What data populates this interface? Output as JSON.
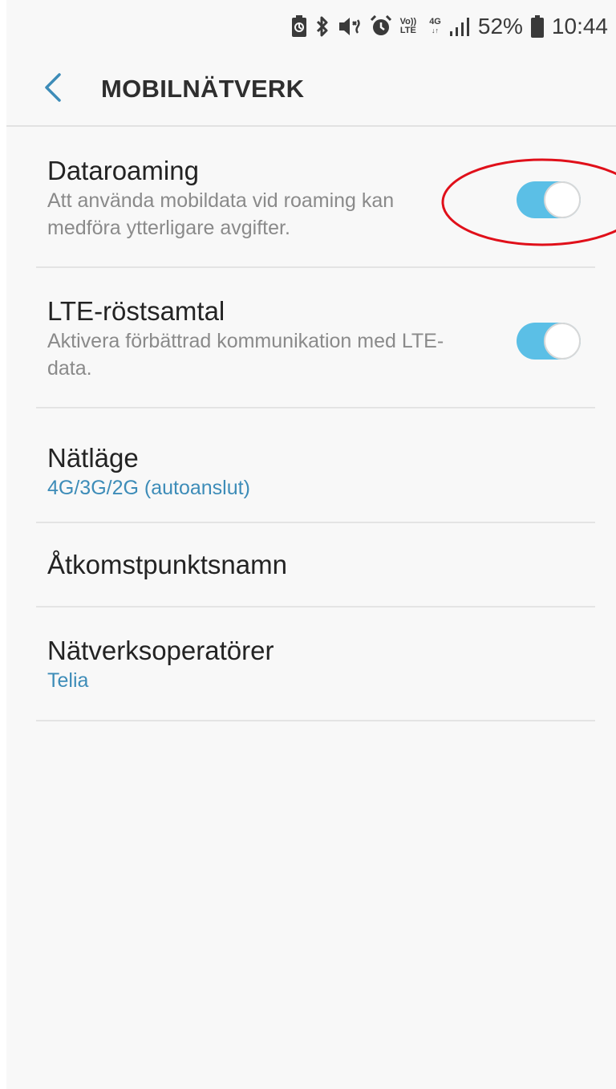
{
  "status_bar": {
    "volte_label_top": "Vo))",
    "volte_label_bottom": "LTE",
    "network_label": "4G",
    "battery": "52%",
    "time": "10:44",
    "icons": [
      "battery-saver-icon",
      "bluetooth-icon",
      "vibrate-mute-icon",
      "alarm-icon",
      "volte-icon",
      "4g-data-icon",
      "signal-icon",
      "battery-icon"
    ]
  },
  "app_bar": {
    "title": "MOBILNÄTVERK",
    "back_icon": "chevron-left-icon"
  },
  "settings": {
    "data_roaming": {
      "title": "Dataroaming",
      "description": "Att använda mobildata vid roaming kan medföra ytterligare avgifter.",
      "enabled": true
    },
    "lte_voice": {
      "title": "LTE-röstsamtal",
      "description": "Aktivera förbättrad kommunikation med LTE-data.",
      "enabled": true
    },
    "network_mode": {
      "title": "Nätläge",
      "value": "4G/3G/2G (autoanslut)"
    },
    "apn": {
      "title": "Åtkomstpunktsnamn"
    },
    "network_operators": {
      "title": "Nätverksoperatörer",
      "value": "Telia"
    }
  },
  "colors": {
    "accent": "#3d8cb8",
    "toggle_on": "#5bbfe6",
    "annotation": "#e0101a",
    "background": "#f8f8f8"
  }
}
